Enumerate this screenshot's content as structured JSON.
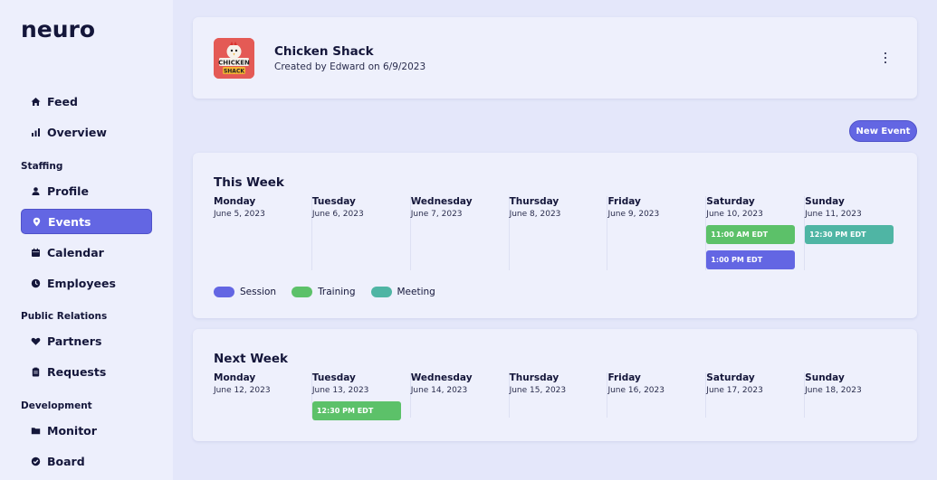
{
  "sidebar": {
    "logo": "neuro",
    "items": [
      {
        "label": "Feed",
        "icon": "home-icon"
      },
      {
        "label": "Overview",
        "icon": "bar-chart-icon"
      },
      {
        "label": "Profile",
        "icon": "person-icon"
      },
      {
        "label": "Events",
        "icon": "location-pin-icon",
        "active": true
      },
      {
        "label": "Calendar",
        "icon": "calendar-icon"
      },
      {
        "label": "Employees",
        "icon": "clock-icon"
      },
      {
        "label": "Partners",
        "icon": "heart-icon"
      },
      {
        "label": "Requests",
        "icon": "clipboard-icon"
      },
      {
        "label": "Monitor",
        "icon": "folder-icon"
      },
      {
        "label": "Board",
        "icon": "check-circle-icon"
      }
    ],
    "sections": [
      "Staffing",
      "Public Relations",
      "Development"
    ]
  },
  "org": {
    "name": "Chicken Shack",
    "subtitle": "Created by Edward on 6/9/2023",
    "logo_text_1": "CHICKEN",
    "logo_text_2": "SHACK"
  },
  "actions": {
    "new_event": "New Event"
  },
  "colors": {
    "accent": "#6366e3",
    "session": "#6366e3",
    "training": "#5cc169",
    "meeting": "#4fb5a4"
  },
  "this_week": {
    "title": "This Week",
    "days": [
      {
        "name": "Monday",
        "date": "June 5, 2023",
        "events": []
      },
      {
        "name": "Tuesday",
        "date": "June 6, 2023",
        "events": []
      },
      {
        "name": "Wednesday",
        "date": "June 7, 2023",
        "events": []
      },
      {
        "name": "Thursday",
        "date": "June 8, 2023",
        "events": []
      },
      {
        "name": "Friday",
        "date": "June 9, 2023",
        "events": []
      },
      {
        "name": "Saturday",
        "date": "June 10, 2023",
        "events": [
          {
            "time": "11:00 AM EDT",
            "type": "training"
          },
          {
            "time": "1:00 PM EDT",
            "type": "session"
          }
        ]
      },
      {
        "name": "Sunday",
        "date": "June 11, 2023",
        "events": [
          {
            "time": "12:30 PM EDT",
            "type": "meeting"
          }
        ]
      }
    ]
  },
  "next_week": {
    "title": "Next Week",
    "days": [
      {
        "name": "Monday",
        "date": "June 12, 2023",
        "events": []
      },
      {
        "name": "Tuesday",
        "date": "June 13, 2023",
        "events": [
          {
            "time": "12:30 PM EDT",
            "type": "training"
          }
        ]
      },
      {
        "name": "Wednesday",
        "date": "June 14, 2023",
        "events": []
      },
      {
        "name": "Thursday",
        "date": "June 15, 2023",
        "events": []
      },
      {
        "name": "Friday",
        "date": "June 16, 2023",
        "events": []
      },
      {
        "name": "Saturday",
        "date": "June 17, 2023",
        "events": []
      },
      {
        "name": "Sunday",
        "date": "June 18, 2023",
        "events": []
      }
    ]
  },
  "legend": [
    {
      "label": "Session",
      "type": "session"
    },
    {
      "label": "Training",
      "type": "training"
    },
    {
      "label": "Meeting",
      "type": "meeting"
    }
  ]
}
